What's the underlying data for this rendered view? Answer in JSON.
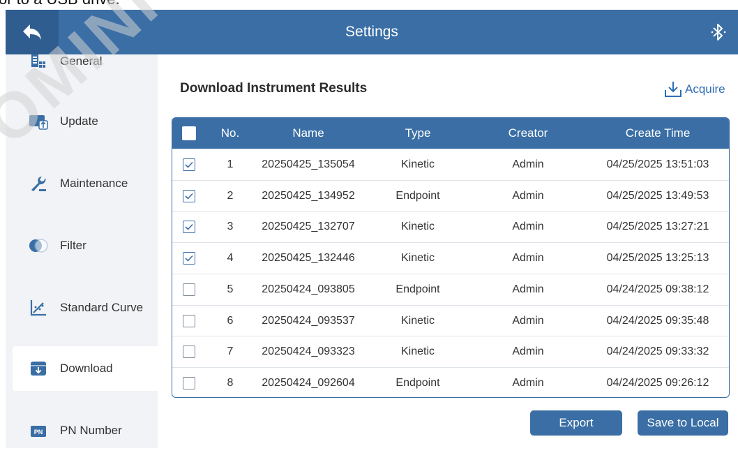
{
  "top_strip": {
    "text": "or to a USB drive."
  },
  "header": {
    "title": "Settings"
  },
  "sidebar": {
    "items": [
      {
        "label": "General",
        "icon": "general-icon"
      },
      {
        "label": "Update",
        "icon": "update-icon"
      },
      {
        "label": "Maintenance",
        "icon": "maintenance-icon"
      },
      {
        "label": "Filter",
        "icon": "filter-icon"
      },
      {
        "label": "Standard Curve",
        "icon": "standard-curve-icon"
      },
      {
        "label": "Download",
        "icon": "download-icon",
        "active": true
      },
      {
        "label": "PN Number",
        "icon": "pn-icon"
      }
    ]
  },
  "main": {
    "title": "Download Instrument Results",
    "acquire_label": "Acquire"
  },
  "table": {
    "columns": [
      "No.",
      "Name",
      "Type",
      "Creator",
      "Create Time"
    ],
    "rows": [
      {
        "checked": true,
        "no": "1",
        "name": "20250425_135054",
        "type": "Kinetic",
        "creator": "Admin",
        "time": "04/25/2025 13:51:03"
      },
      {
        "checked": true,
        "no": "2",
        "name": "20250425_134952",
        "type": "Endpoint",
        "creator": "Admin",
        "time": "04/25/2025 13:49:53"
      },
      {
        "checked": true,
        "no": "3",
        "name": "20250425_132707",
        "type": "Kinetic",
        "creator": "Admin",
        "time": "04/25/2025 13:27:21"
      },
      {
        "checked": true,
        "no": "4",
        "name": "20250425_132446",
        "type": "Kinetic",
        "creator": "Admin",
        "time": "04/25/2025 13:25:13"
      },
      {
        "checked": false,
        "no": "5",
        "name": "20250424_093805",
        "type": "Endpoint",
        "creator": "Admin",
        "time": "04/24/2025 09:38:12"
      },
      {
        "checked": false,
        "no": "6",
        "name": "20250424_093537",
        "type": "Kinetic",
        "creator": "Admin",
        "time": "04/24/2025 09:35:48"
      },
      {
        "checked": false,
        "no": "7",
        "name": "20250424_093323",
        "type": "Kinetic",
        "creator": "Admin",
        "time": "04/24/2025 09:33:32"
      },
      {
        "checked": false,
        "no": "8",
        "name": "20250424_092604",
        "type": "Endpoint",
        "creator": "Admin",
        "time": "04/24/2025 09:26:12"
      }
    ]
  },
  "buttons": {
    "export": "Export",
    "save_local": "Save to Local"
  },
  "watermark": {
    "text": "OMINIQU"
  },
  "colors": {
    "primary": "#3a6ea5",
    "primary_dark": "#2f5d8f",
    "sidebar_bg": "#f1f3f6",
    "link": "#2f6db5"
  }
}
